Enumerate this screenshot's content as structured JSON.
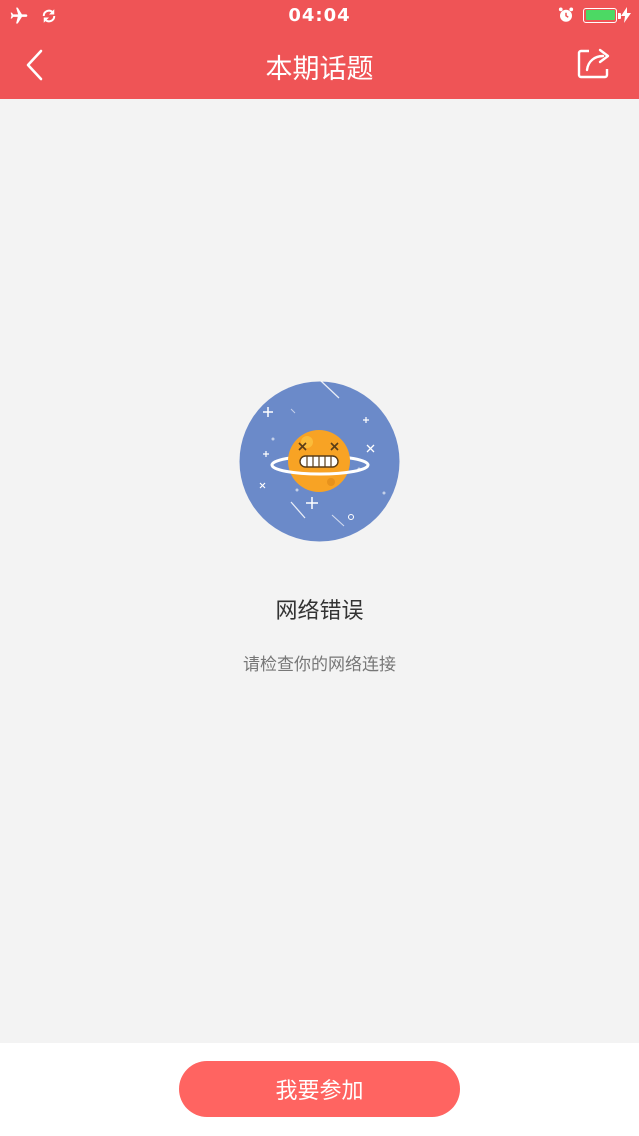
{
  "status_bar": {
    "time": "04:04",
    "left_icons": [
      "airplane-icon",
      "sync-icon"
    ],
    "right_icons": [
      "alarm-icon",
      "battery-icon",
      "charging-icon"
    ],
    "battery_level": 0.95,
    "battery_color": "#4cd964"
  },
  "navbar": {
    "title": "本期话题",
    "back_icon": "chevron-left-icon",
    "share_icon": "share-icon",
    "background": "#ef5456"
  },
  "error_state": {
    "illustration": "planet-error-icon",
    "title": "网络错误",
    "subtitle": "请检查你的网络连接"
  },
  "footer": {
    "join_button_label": "我要参加",
    "button_color": "#ff6461"
  }
}
